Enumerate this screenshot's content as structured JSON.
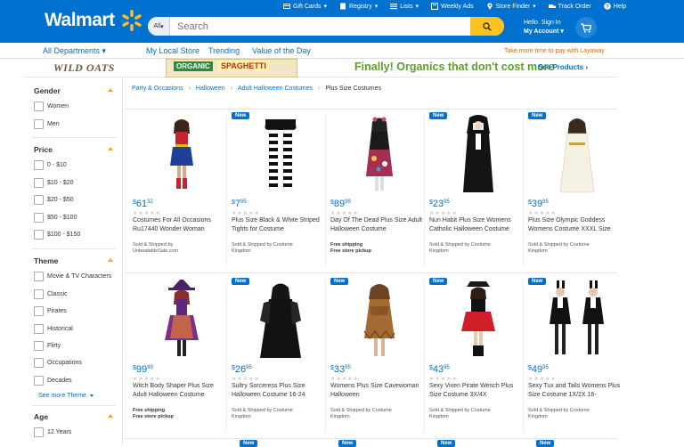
{
  "header": {
    "logo_text": "Walmart",
    "search_dept": "All",
    "search_placeholder": "Search",
    "top_links": [
      "Gift Cards",
      "Registry",
      "Lists",
      "Weekly Ads",
      "Store Finder",
      "Track Order",
      "Help"
    ],
    "account_line1": "Hello. Sign In",
    "account_line2": "My Account"
  },
  "nav": {
    "departments": "All Departments",
    "my_local_store": "My Local Store",
    "trending": "Trending",
    "value_of_day": "Value of the Day",
    "layaway": "Take more time to pay with Layaway"
  },
  "banner": {
    "brand": "WILD OATS",
    "organic": "ORGANIC",
    "product": "SPAGHETTI",
    "headline": "Finally! Organics that don't cost more",
    "link": "See Products"
  },
  "breadcrumb": [
    "Party & Occasions",
    "Halloween",
    "Adult Halloween Costumes",
    "Plus Size Costumes"
  ],
  "facets": {
    "gender": {
      "title": "Gender",
      "options": [
        "Women",
        "Men"
      ]
    },
    "price": {
      "title": "Price",
      "options": [
        "0 - $10",
        "$10 - $20",
        "$20 - $50",
        "$50 - $100",
        "$100 - $150"
      ]
    },
    "theme": {
      "title": "Theme",
      "options": [
        "Movie & TV Characters",
        "Classic",
        "Pirates",
        "Historical",
        "Flirty",
        "Occupations",
        "Decades"
      ],
      "see_more": "See more Theme"
    },
    "age": {
      "title": "Age",
      "options": [
        "12 Years"
      ]
    }
  },
  "badge_new": "New",
  "products": [
    {
      "name": "Costumes For All Occasions Ru17440 Wonder Woman",
      "dollars": "61",
      "cents": "32",
      "is_new": false,
      "ship1": "Sold & Shipped by",
      "ship2": "UnbeatableSale.com",
      "free": false
    },
    {
      "name": "Plus Size Black & White Striped Tights for Costume",
      "dollars": "7",
      "cents": "95",
      "is_new": true,
      "ship1": "Sold & Shipped by Costume",
      "ship2": "Kingdom",
      "free": false
    },
    {
      "name": "Day Of The Dead Plus Size Adult Halloween Costume",
      "dollars": "89",
      "cents": "99",
      "is_new": false,
      "ship1": "Free shipping",
      "ship2": "Free store pickup",
      "free": true
    },
    {
      "name": "Nun Habit Plus Size Womens Catholic Halloween Costume",
      "dollars": "23",
      "cents": "95",
      "is_new": true,
      "ship1": "Sold & Shipped by Costume",
      "ship2": "Kingdom",
      "free": false
    },
    {
      "name": "Plus Size Olympic Goddess Womens Costume XXXL Size",
      "dollars": "39",
      "cents": "95",
      "is_new": true,
      "ship1": "Sold & Shipped by Costume",
      "ship2": "Kingdom",
      "free": false
    },
    {
      "name": "Witch Body Shaper Plus Size Adult Halloween Costume",
      "dollars": "99",
      "cents": "99",
      "is_new": false,
      "ship1": "Free shipping",
      "ship2": "Free store pickup",
      "free": true
    },
    {
      "name": "Sultry Sorceress Plus Size Halloween Costume 16-24",
      "dollars": "26",
      "cents": "95",
      "is_new": true,
      "ship1": "Sold & Shipped by Costume",
      "ship2": "Kingdom",
      "free": false
    },
    {
      "name": "Womens Plus Size Cavewoman Halloween",
      "dollars": "33",
      "cents": "95",
      "is_new": true,
      "ship1": "Sold & Shipped by Costume",
      "ship2": "Kingdom",
      "free": false
    },
    {
      "name": "Sexy Vixen Pirate Wench Plus Size Costume 3X/4X",
      "dollars": "43",
      "cents": "95",
      "is_new": true,
      "ship1": "Sold & Shipped by Costume",
      "ship2": "Kingdom",
      "free": false
    },
    {
      "name": "Sexy Tux and Tails Womens Plus Size Costume 1X/2X 16-",
      "dollars": "49",
      "cents": "95",
      "is_new": true,
      "ship1": "Sold & Shipped by Costume",
      "ship2": "Kingdom",
      "free": false
    }
  ],
  "colors": {
    "brand_blue": "#0071ce",
    "spark_yellow": "#ffc220",
    "organic_green": "#5aa02c",
    "layaway_orange": "#d96b00"
  }
}
